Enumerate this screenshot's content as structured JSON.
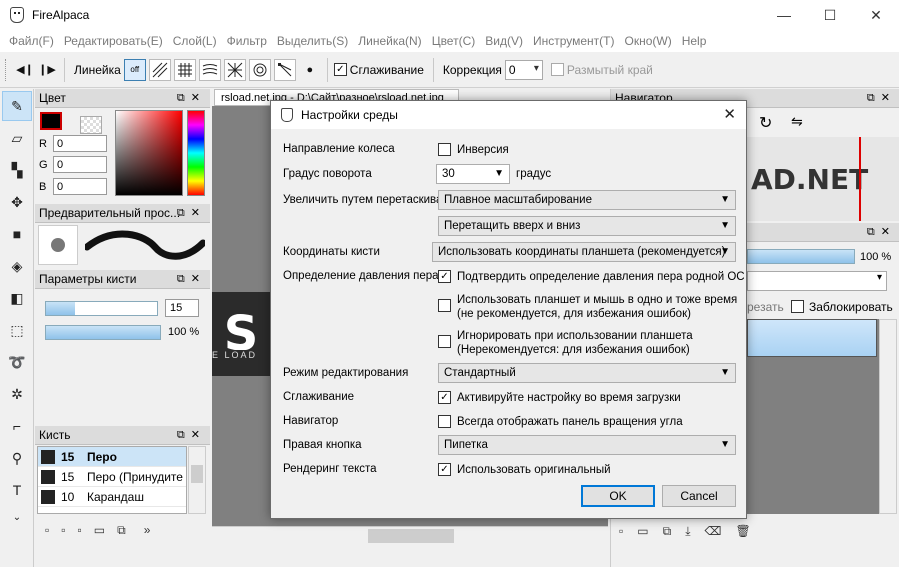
{
  "app": {
    "title": "FireAlpaca",
    "win_minimize": "—",
    "win_maximize": "☐",
    "win_close": "✕"
  },
  "menu": [
    "Файл(F)",
    "Редактировать(E)",
    "Слой(L)",
    "Фильтр",
    "Выделить(S)",
    "Линейка(N)",
    "Цвет(C)",
    "Вид(V)",
    "Инструмент(T)",
    "Окно(W)",
    "Help"
  ],
  "toolbar": {
    "ruler_label": "Линейка",
    "ruler_off": "off",
    "antialias_label": "Сглаживание",
    "correction_label": "Коррекция",
    "correction_value": "0",
    "soft_edge_label": "Размытый край"
  },
  "panels": {
    "color_title": "Цвет",
    "r_label": "R",
    "r_value": "0",
    "g_label": "G",
    "g_value": "0",
    "b_label": "B",
    "b_value": "0",
    "preview_title": "Предварительный прос...",
    "brush_params_title": "Параметры кисти",
    "brush_size_value": "15",
    "brush_opacity_value": "100 %",
    "brush_title": "Кисть",
    "brushes": [
      {
        "size": "15",
        "name": "Перо"
      },
      {
        "size": "15",
        "name": "Перо (Принудите"
      },
      {
        "size": "10",
        "name": "Карандаш"
      }
    ],
    "navigator_title": "Навигатор",
    "layer_opacity": "100 %",
    "cut_label": "резать",
    "lock_label": "Заблокировать"
  },
  "document": {
    "tab_title": "rsload.net.jpg - D:\\Сайт\\разное\\rsload.net.jpg",
    "logo_big": "S",
    "logo_small": "E LOAD",
    "nav_logo": "AD.NET"
  },
  "dialog": {
    "title": "Настройки среды",
    "close": "✕",
    "wheel_label": "Направление колеса",
    "wheel_invert": "Инверсия",
    "rotate_label": "Градус поворота",
    "rotate_value": "30",
    "rotate_unit": "градус",
    "zoom_drag_label": "Увеличить путем перетаскивания",
    "zoom_drag_value": "Плавное масштабирование",
    "zoom_drag_value2": "Перетащить вверх и вниз",
    "brush_coords_label": "Координаты кисти",
    "brush_coords_value": "Использовать координаты планшета (рекомендуется)",
    "pressure_label": "Определение давления пера",
    "pressure_opt1": "Подтвердить определение давления пера родной ОС",
    "pressure_opt2_l1": "Использовать планшет и мышь в одно и тоже время",
    "pressure_opt2_l2": "(не рекомендуется, для избежания ошибок)",
    "pressure_opt3_l1": "Игнорировать при использовании планшета",
    "pressure_opt3_l2": "(Нерекомендуется: для избежания ошибок)",
    "edit_mode_label": "Режим редактирования",
    "edit_mode_value": "Стандартный",
    "smoothing_label": "Сглаживание",
    "smoothing_opt": "Активируйте настройку во время загрузки",
    "navigator_label": "Навигатор",
    "navigator_opt": "Всегда отображать панель вращения угла",
    "right_btn_label": "Правая кнопка",
    "right_btn_value": "Пипетка",
    "text_render_label": "Рендеринг текста",
    "text_render_opt": "Использовать оригинальный",
    "ok": "OK",
    "cancel": "Cancel",
    "check_mark": "✓"
  },
  "colors": {
    "accent": "#0078d7",
    "selection": "#cce4f7"
  }
}
